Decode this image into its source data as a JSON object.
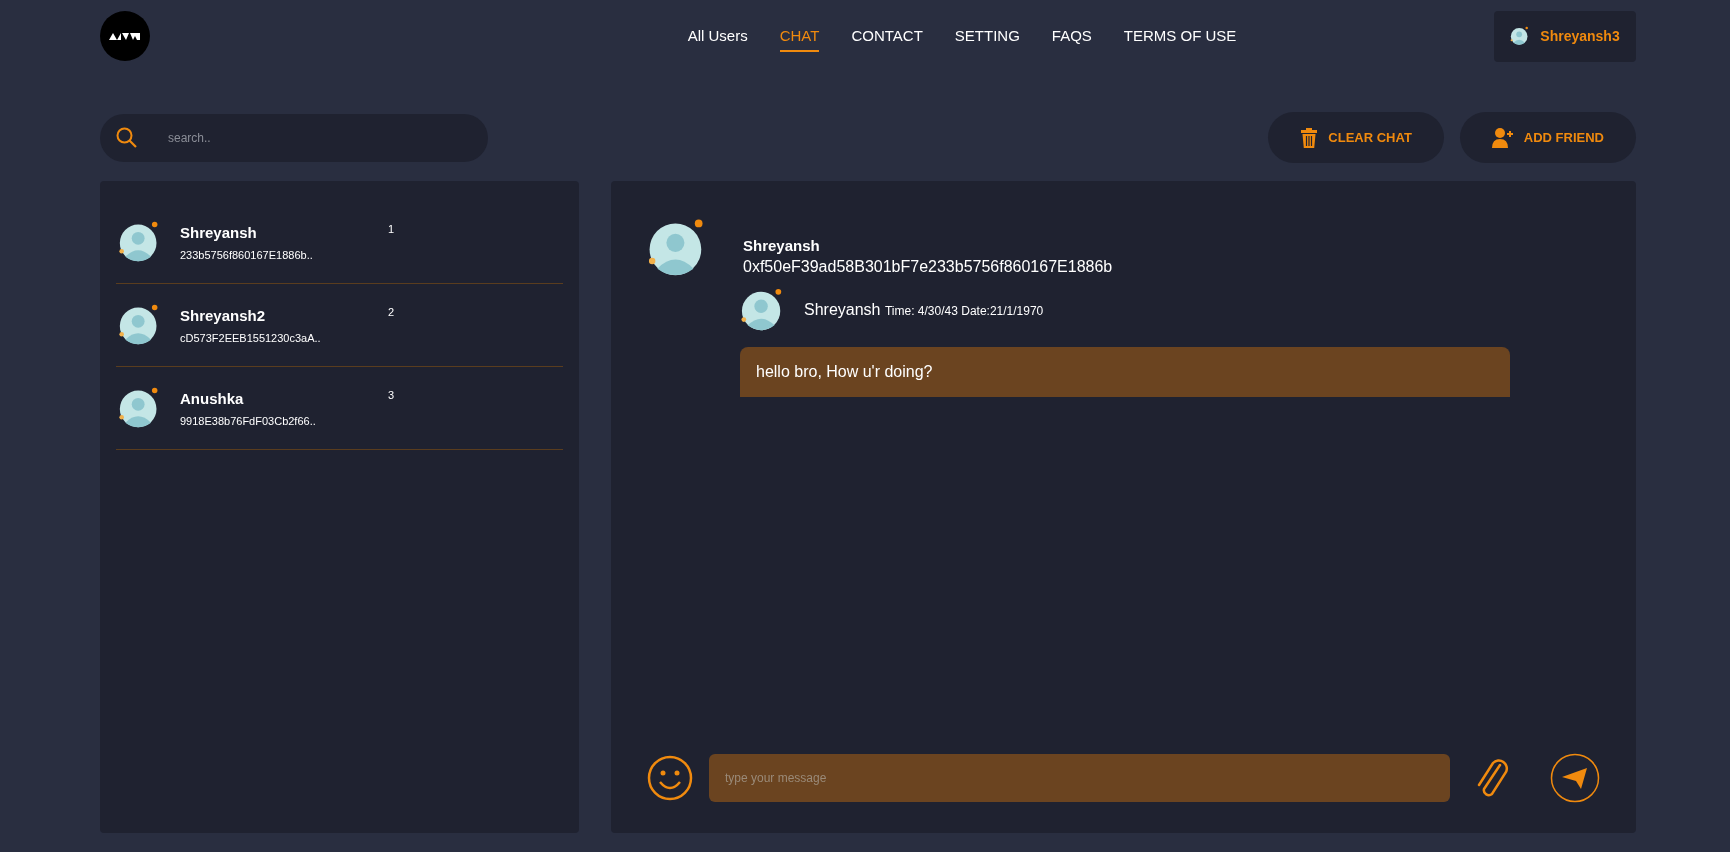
{
  "nav": [
    {
      "label": "All Users",
      "selected": false
    },
    {
      "label": "CHAT",
      "selected": true
    },
    {
      "label": "CONTACT",
      "selected": false
    },
    {
      "label": "SETTING",
      "selected": false
    },
    {
      "label": "FAQS",
      "selected": false
    },
    {
      "label": "TERMS OF USE",
      "selected": false
    }
  ],
  "account": {
    "name": "Shreyansh3"
  },
  "search": {
    "placeholder": "search.."
  },
  "actions": [
    {
      "kind": "clear",
      "label": "CLEAR CHAT"
    },
    {
      "kind": "add",
      "label": "ADD FRIEND"
    }
  ],
  "contacts": [
    {
      "name": "Shreyansh",
      "address": "233b5756f860167E1886b..",
      "index": "1"
    },
    {
      "name": "Shreyansh2",
      "address": "cD573F2EEB1551230c3aA..",
      "index": "2"
    },
    {
      "name": "Anushka",
      "address": "9918E38b76FdF03Cb2f66..",
      "index": "3"
    }
  ],
  "chat": {
    "name": "Shreyansh",
    "address": "0xf50eF39ad58B301bF7e233b5756f860167E1886b",
    "messages": [
      {
        "sender": "Shreyansh",
        "meta": "Time: 4/30/43 Date:21/1/1970",
        "text": "hello bro, How u'r doing?"
      }
    ],
    "composer": {
      "placeholder": "type your message"
    }
  }
}
